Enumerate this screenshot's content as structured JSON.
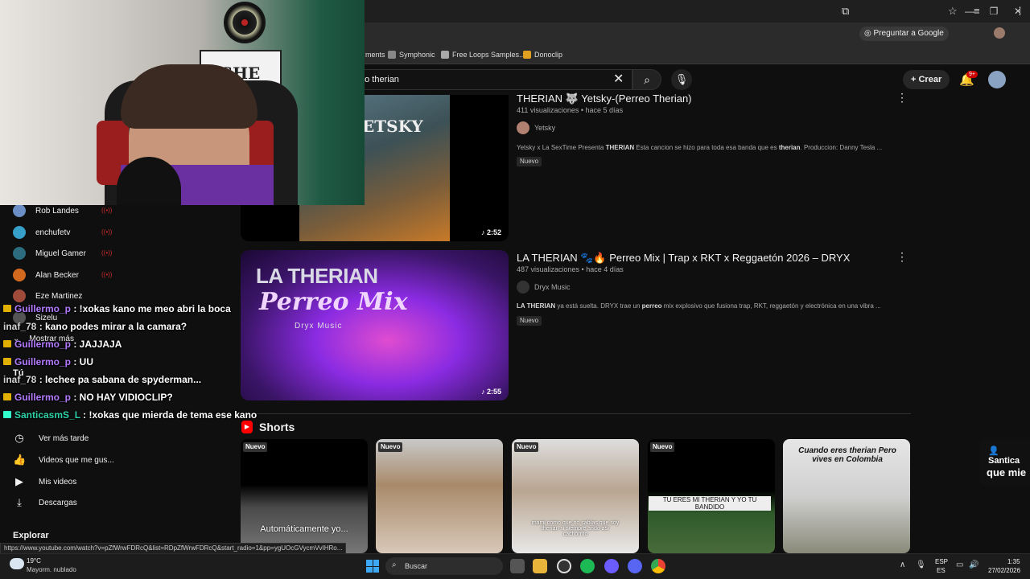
{
  "browser": {
    "ask_google": "Preguntar a Google",
    "bookmarks": [
      "ments",
      "Symphonic",
      "Free Loops Samples...",
      "Donoclip"
    ],
    "status_url": "https://www.youtube.com/watch?v=pZfWrwFDRcQ&list=RDpZfWrwFDRcQ&start_radio=1&pp=ygUOcGVycmVvIHRo..."
  },
  "youtube": {
    "search_value": "eo therian",
    "create_label": "Crear",
    "notif_count": "9+"
  },
  "webcam": {
    "sign_text": "SHE"
  },
  "sidebar": {
    "subscriptions": [
      {
        "name": "Rob Landes",
        "live": true
      },
      {
        "name": "enchufetv",
        "live": true
      },
      {
        "name": "Miguel Gamer",
        "live": true
      },
      {
        "name": "Alan Becker",
        "live": true
      },
      {
        "name": "Eze Martinez",
        "live": false
      },
      {
        "name": "Sizelu",
        "live": false
      }
    ],
    "show_more": "Mostrar más",
    "you_label": "Tú",
    "nav": [
      "Ver más tarde",
      "Videos que me gus...",
      "Mis videos",
      "Descargas"
    ],
    "explore": "Explorar"
  },
  "chat": [
    {
      "user": "Guillermo_p",
      "msg": " : !xokas kano me meo abri la boca",
      "style": "u1",
      "badge": true
    },
    {
      "user": "inaf_78",
      "msg": " : kano podes mirar a la camara?",
      "style": "u2",
      "badge": false
    },
    {
      "user": "Guillermo_p",
      "msg": " : JAJJAJA",
      "style": "u1",
      "badge": true
    },
    {
      "user": "Guillermo_p",
      "msg": " : UU",
      "style": "u1",
      "badge": true
    },
    {
      "user": "inaf_78",
      "msg": " : lechee pa sabana de spyderman...",
      "style": "u2",
      "badge": false
    },
    {
      "user": "Guillermo_p",
      "msg": " : NO HAY VIDIOCLIP?",
      "style": "u1",
      "badge": true
    },
    {
      "user": "SanticasmS_L",
      "msg": " : !xokas que mierda de tema ese kano",
      "style": "u3",
      "badge": true
    }
  ],
  "videos": [
    {
      "title": "THERIAN 🐺 Yetsky-(Perreo Therian)",
      "meta": "411 visualizaciones • hace 5 días",
      "channel": "Yetsky",
      "desc_pre": "Yetsky x La SexTime Presenta ",
      "desc_b1": "THERIAN",
      "desc_mid": " Esta cancion se hizo para toda esa banda que es ",
      "desc_b2": "therian",
      "desc_post": ". Produccion: Danny Tesla ...",
      "badge": "Nuevo",
      "duration": "2:52",
      "thumb_text": "ETSKY"
    },
    {
      "title": "LA THERIAN 🐾🔥 Perreo Mix | Trap x RKT x Reggaetón 2026 – DRYX",
      "meta": "487 visualizaciones • hace 4 días",
      "channel": "Dryx Music",
      "desc_pre": "LA THERIAN",
      "desc_b1": "",
      "desc_mid": " ya está suelta. DRYX trae un ",
      "desc_b2": "perreo",
      "desc_post": " mix explosivo que fusiona trap, RKT, reggaetón y electrónica en una vibra ...",
      "badge": "Nuevo",
      "duration": "2:55",
      "thumb_t1": "LA THERIAN",
      "thumb_t2": "Perreo Mix",
      "thumb_t3": "Dryx Music"
    }
  ],
  "shorts": {
    "title": "Shorts",
    "items": [
      {
        "badge": "Nuevo",
        "caption": "Automáticamente yo..."
      },
      {
        "badge": "Nuevo",
        "caption": ""
      },
      {
        "badge": "Nuevo",
        "caption": "mami como que no sabías que soy therian si siempre ando así cachorrito"
      },
      {
        "badge": "Nuevo",
        "caption": "TU ERES MI THERIAN Y YO TU BANDIDO"
      },
      {
        "badge": "",
        "caption": "Cuando eres therian Pero vives en Colombia"
      }
    ]
  },
  "overlay_card": {
    "name": "Santica",
    "msg": "que mie"
  },
  "taskbar": {
    "temp": "19°C",
    "weather": "Mayorm. nublado",
    "search": "Buscar",
    "lang1": "ESP",
    "lang2": "ES",
    "time": "1:35",
    "date": "27/02/2026"
  },
  "colors": {
    "accent_red": "#cc0000",
    "chat_purple": "#b47bff",
    "chat_teal": "#2fd1a8"
  }
}
